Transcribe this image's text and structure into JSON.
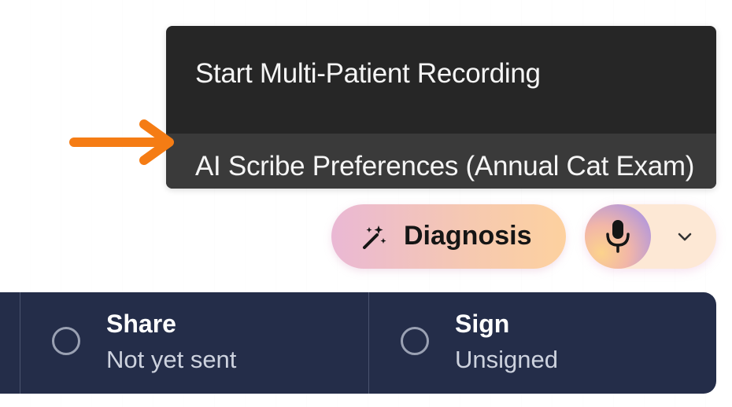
{
  "menu": {
    "items": [
      {
        "label": "Start Multi-Patient Recording"
      },
      {
        "label": "AI Scribe Preferences (Annual Cat Exam)"
      }
    ]
  },
  "annotation": {
    "icon": "arrow-right-icon",
    "color": "#f57c14"
  },
  "diagnosis_button": {
    "label": "Diagnosis",
    "icon": "magic-wand-icon"
  },
  "recording": {
    "mic_icon": "microphone-icon",
    "dropdown_icon": "chevron-down-icon"
  },
  "status": {
    "steps": [
      {
        "title": "Share",
        "subtitle": "Not yet sent"
      },
      {
        "title": "Sign",
        "subtitle": "Unsigned"
      }
    ]
  },
  "colors": {
    "menu_bg": "#262626",
    "menu_highlight": "#3a3a3a",
    "status_bar_bg": "#242d49",
    "arrow": "#f57c14"
  }
}
